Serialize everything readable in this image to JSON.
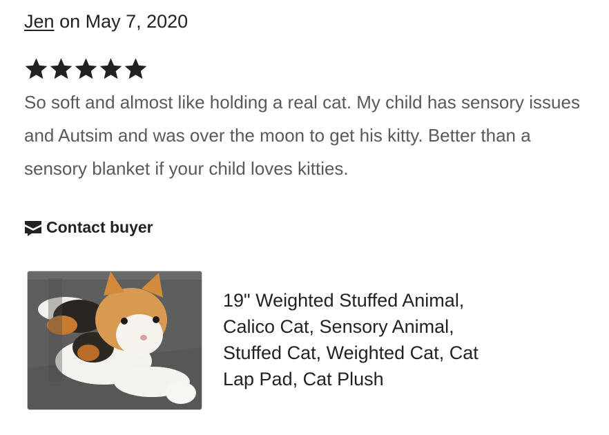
{
  "review": {
    "author": "Jen",
    "date_text": "on May 7, 2020",
    "rating": 5,
    "text": "So soft and almost like holding a real cat. My child has sensory issues and Autsim and was over the moon to get his kitty. Better than a sensory blanket if your child loves kitties.",
    "contact_label": "Contact buyer"
  },
  "listing": {
    "title": "19\" Weighted Stuffed Animal, Calico Cat, Sensory Animal, Stuffed Cat, Weighted Cat, Cat Lap Pad, Cat Plush"
  },
  "icons": {
    "star": "star-icon",
    "contact": "envelope-icon"
  },
  "colors": {
    "text_primary": "#222222",
    "text_secondary": "#595959"
  }
}
